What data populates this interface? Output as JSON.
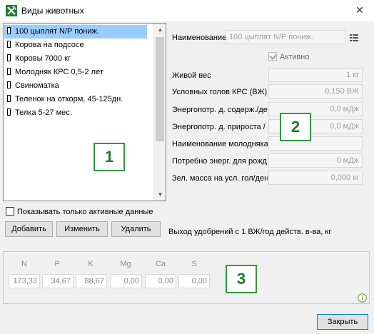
{
  "window": {
    "title": "Виды животных",
    "close_glyph": "✕"
  },
  "animals": {
    "items": [
      "100 цыплят N/P пониж.",
      "Корова на подсосе",
      "Коровы 7000 кг",
      "Молодняк КРС 0,5-2 лет",
      "Свиноматка",
      "Теленок на откорм, 45-125дн.",
      "Телка 5-27 мес."
    ],
    "selected_index": 0,
    "show_only_active_label": "Показывать только активные данные",
    "add_label": "Добавить",
    "edit_label": "Изменить",
    "delete_label": "Удалить"
  },
  "form": {
    "name_label": "Наименование",
    "name_value": "100 цыплят N/P пониж.",
    "active_label": "Активно",
    "live_weight_label": "Живой вес",
    "live_weight_value": "1 кг",
    "cattle_heads_label": "Условных голов КРС (ВЖ)",
    "cattle_heads_value": "0,150 ВЖ",
    "energy_maint_label": "Энергопотр. д. содерж./де",
    "energy_maint_value": "0,0 мДж",
    "energy_growth_label": "Энергопотр. д. прироста /",
    "energy_growth_value": "0,0 мДж",
    "young_name_label": "Наименование молодняка",
    "young_name_value": "",
    "birth_energy_label": "Потребно энерг. для рожд",
    "birth_energy_value": "0 мДж",
    "green_mass_label": "Зел. масса на усл. гол/день",
    "green_mass_value": "0,000 кг",
    "manure_output_label": "Выход удобрений с 1 ВЖ/год действ. в-ва, кг"
  },
  "nutrients": {
    "headers": [
      "N",
      "P",
      "K",
      "Mg",
      "Ca",
      "S"
    ],
    "values": [
      "173,33",
      "34,67",
      "88,67",
      "0,00",
      "0,00",
      "0,00"
    ]
  },
  "badges": [
    "1",
    "2",
    "3"
  ],
  "footer": {
    "close_label": "Закрыть"
  },
  "colors": {
    "selection": "#99ccff",
    "badge_border": "#2e9a3e",
    "badge_text": "#198032",
    "primary_border": "#0078d7"
  }
}
